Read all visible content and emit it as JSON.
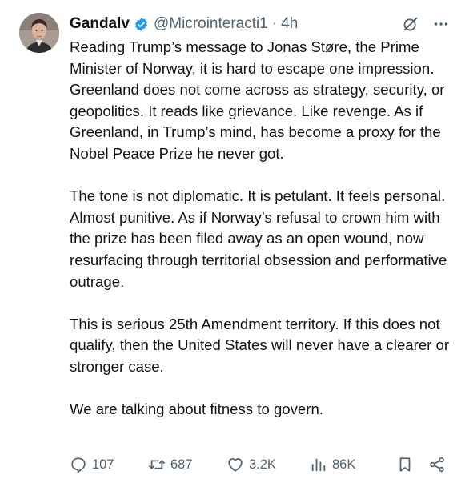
{
  "tweet": {
    "author_name": "Gandalv",
    "handle": "@Microinteracti1",
    "separator": "·",
    "time": "4h",
    "paragraphs": [
      "Reading Trump’s message to Jonas Støre, the Prime Minister of Norway, it is hard to escape one impression. Greenland does not come across as strategy, security, or geopolitics. It reads like grievance. Like revenge. As if Greenland, in Trump’s mind, has become a proxy for the Nobel Peace Prize he never got.",
      "The tone is not diplomatic. It is petulant. It feels personal. Almost punitive. As if Norway’s refusal to crown him with the prize has been filed away as an open wound, now resurfacing through territorial obsession and performative outrage.",
      "This is serious 25th Amendment territory. If this does not qualify, then the United States will never have a clearer or stronger case.",
      "We are talking about fitness to govern."
    ]
  },
  "actions": {
    "replies": "107",
    "reposts": "687",
    "likes": "3.2K",
    "views": "86K"
  },
  "icons": [
    "verified-badge-icon",
    "grok-icon",
    "more-icon",
    "reply-icon",
    "repost-icon",
    "like-icon",
    "views-icon",
    "bookmark-icon",
    "share-icon"
  ],
  "colors": {
    "text": "#0f1419",
    "secondary": "#536471",
    "verified": "#1d9bf0"
  }
}
